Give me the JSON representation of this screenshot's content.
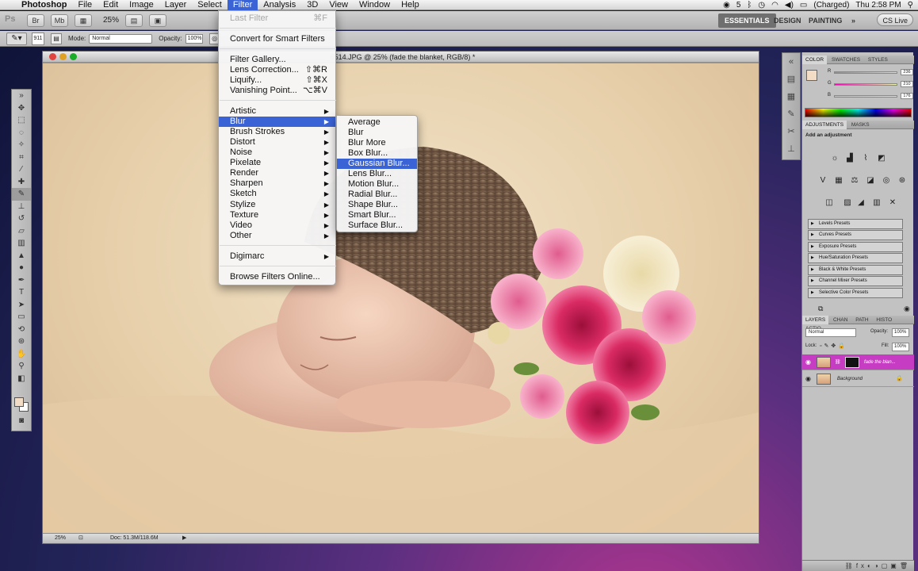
{
  "menubar": {
    "apple": "",
    "app": "Photoshop",
    "items": [
      "File",
      "Edit",
      "Image",
      "Layer",
      "Select",
      "Filter",
      "Analysis",
      "3D",
      "View",
      "Window",
      "Help"
    ],
    "active": "Filter",
    "status": {
      "badge": "5",
      "battery": "(Charged)",
      "clock": "Thu 2:58 PM"
    }
  },
  "appbar": {
    "logo": "Ps",
    "zoom": "25%",
    "workspaces": [
      "ESSENTIALS",
      "DESIGN",
      "PAINTING"
    ],
    "more": "»",
    "cs_live": "CS Live"
  },
  "options": {
    "brush_size": "911",
    "mode_label": "Mode:",
    "mode_value": "Normal",
    "opacity_label": "Opacity:",
    "opacity_value": "100%"
  },
  "document": {
    "title": "_6514.JPG @ 25% (fade the blanket, RGB/8) *",
    "status_zoom": "25%",
    "status_doc": "Doc: 51.3M/118.6M",
    "fg_color": "#f2dcc6"
  },
  "filter_menu": {
    "last_filter": "Last Filter",
    "last_filter_shortcut": "⌘F",
    "convert": "Convert for Smart Filters",
    "gallery": "Filter Gallery...",
    "lens_correction": "Lens Correction...",
    "lens_correction_shortcut": "⇧⌘R",
    "liquify": "Liquify...",
    "liquify_shortcut": "⇧⌘X",
    "vanishing": "Vanishing Point...",
    "vanishing_shortcut": "⌥⌘V",
    "groups": [
      "Artistic",
      "Blur",
      "Brush Strokes",
      "Distort",
      "Noise",
      "Pixelate",
      "Render",
      "Sharpen",
      "Sketch",
      "Stylize",
      "Texture",
      "Video",
      "Other"
    ],
    "digimarc": "Digimarc",
    "browse": "Browse Filters Online..."
  },
  "blur_menu": {
    "items": [
      "Average",
      "Blur",
      "Blur More",
      "Box Blur...",
      "Gaussian Blur...",
      "Lens Blur...",
      "Motion Blur...",
      "Radial Blur...",
      "Shape Blur...",
      "Smart Blur...",
      "Surface Blur..."
    ],
    "highlighted": "Gaussian Blur..."
  },
  "color_panel": {
    "tabs": [
      "COLOR",
      "SWATCHES",
      "STYLES"
    ],
    "r": "236",
    "g": "210",
    "b": "176",
    "labels": [
      "R",
      "G",
      "B"
    ]
  },
  "adjustments_panel": {
    "tabs": [
      "ADJUSTMENTS",
      "MASKS"
    ],
    "heading": "Add an adjustment",
    "presets": [
      "Levels Presets",
      "Curves Presets",
      "Exposure Presets",
      "Hue/Saturation Presets",
      "Black & White Presets",
      "Channel Mixer Presets",
      "Selective Color Presets"
    ]
  },
  "layers_panel": {
    "tabs": [
      "LAYERS",
      "CHAN",
      "PATH",
      "HISTO",
      "ACTIO"
    ],
    "blend": "Normal",
    "opacity_label": "Opacity:",
    "opacity": "100%",
    "lock_label": "Lock:",
    "fill_label": "Fill:",
    "fill": "100%",
    "layers": [
      "fade the blan...",
      "Background"
    ]
  }
}
